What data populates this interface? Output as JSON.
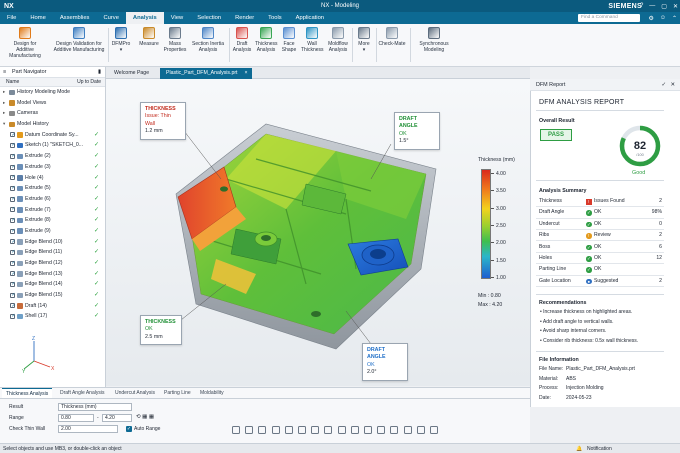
{
  "app": {
    "logo": "NX",
    "window_title": "NX - Modeling",
    "brand": "SIEMENS",
    "window_controls": [
      "?",
      "—",
      "▢",
      "✕"
    ]
  },
  "menu": {
    "items": [
      "File",
      "Home",
      "Assemblies",
      "Curve",
      "Analysis",
      "View",
      "Selection",
      "Render",
      "Tools",
      "Application"
    ],
    "active": "Analysis",
    "search_placeholder": "Find a Command"
  },
  "ribbon": {
    "buttons": [
      {
        "label": "Design for\nAdditive Manufacturing",
        "icon": "additive-icon",
        "color": "#e07b1a"
      },
      {
        "label": "Design Validation for\nAdditive Manufacturing",
        "icon": "validation-icon",
        "color": "#3f7fc1"
      },
      {
        "label": "DFMPro\n▾",
        "icon": "dfmpro-icon",
        "color": "#2c6fb0"
      },
      {
        "label": "Measure",
        "icon": "measure-icon",
        "color": "#c98a2a"
      },
      {
        "label": "Mass\nProperties",
        "icon": "mass-icon",
        "color": "#6b7b8c"
      },
      {
        "label": "Section Inertia\nAnalysis",
        "icon": "section-icon",
        "color": "#4f86c6"
      },
      {
        "label": "Draft\nAnalysis",
        "icon": "draft-icon",
        "color": "#d9534f"
      },
      {
        "label": "Thickness\nAnalysis",
        "icon": "thickness-icon",
        "color": "#3aa655"
      },
      {
        "label": "Face\nShape",
        "icon": "face-icon",
        "color": "#5b8fd1"
      },
      {
        "label": "Wall\nThickness",
        "icon": "wall-icon",
        "color": "#2f95c4"
      },
      {
        "label": "Moldflow\nAnalysis",
        "icon": "moldflow-icon",
        "color": "#8a9aab"
      },
      {
        "label": "More\n▾",
        "icon": "more-icon",
        "color": "#6b7b8c"
      },
      {
        "label": "Check-Mate",
        "icon": "checkmate-icon",
        "color": "#8a9aab"
      },
      {
        "label": "Synchronous\nModeling",
        "icon": "sync-icon",
        "color": "#5d6d7e"
      }
    ]
  },
  "navigator": {
    "title": "Part Navigator",
    "col_name": "Name",
    "col_uptodate": "Up to Date",
    "rows": [
      {
        "label": "History Modeling Mode",
        "indent": 1,
        "cb": false,
        "chk": false
      },
      {
        "label": "Model Views",
        "indent": 1,
        "cb": false,
        "chk": false
      },
      {
        "label": "Cameras",
        "indent": 1,
        "cb": false,
        "chk": false
      },
      {
        "label": "Model History",
        "indent": 1,
        "cb": false,
        "chk": false
      },
      {
        "label": "Datum Coordinate Sy...",
        "indent": 2,
        "cb": true,
        "chk": true
      },
      {
        "label": "Sketch (1) \"SKETCH_0...",
        "indent": 2,
        "cb": true,
        "chk": true
      },
      {
        "label": "Extrude (2)",
        "indent": 2,
        "cb": true,
        "chk": true
      },
      {
        "label": "Extrude (3)",
        "indent": 2,
        "cb": true,
        "chk": true
      },
      {
        "label": "Hole (4)",
        "indent": 2,
        "cb": true,
        "chk": true
      },
      {
        "label": "Extrude (5)",
        "indent": 2,
        "cb": true,
        "chk": true
      },
      {
        "label": "Extrude (6)",
        "indent": 2,
        "cb": true,
        "chk": true
      },
      {
        "label": "Extrude (7)",
        "indent": 2,
        "cb": true,
        "chk": true
      },
      {
        "label": "Extrude (8)",
        "indent": 2,
        "cb": true,
        "chk": true
      },
      {
        "label": "Extrude (9)",
        "indent": 2,
        "cb": true,
        "chk": true
      },
      {
        "label": "Edge Blend (10)",
        "indent": 2,
        "cb": true,
        "chk": true
      },
      {
        "label": "Edge Blend (11)",
        "indent": 2,
        "cb": true,
        "chk": true
      },
      {
        "label": "Edge Blend (12)",
        "indent": 2,
        "cb": true,
        "chk": true
      },
      {
        "label": "Edge Blend (13)",
        "indent": 2,
        "cb": true,
        "chk": true
      },
      {
        "label": "Edge Blend (14)",
        "indent": 2,
        "cb": true,
        "chk": true
      },
      {
        "label": "Edge Blend (15)",
        "indent": 2,
        "cb": true,
        "chk": true
      },
      {
        "label": "Draft (14)",
        "indent": 2,
        "cb": true,
        "chk": true
      },
      {
        "label": "Shell (17)",
        "indent": 2,
        "cb": true,
        "chk": true
      }
    ],
    "triad": {
      "x": "X",
      "y": "Y",
      "z": "Z"
    }
  },
  "doc_tabs": {
    "welcome": "Welcome Page",
    "active": "Plastic_Part_DFM_Analysis.prt",
    "close": "×"
  },
  "viewport": {
    "callouts": {
      "thickness_issue": {
        "title": "THICKNESS",
        "line2": "Issue: Thin Wall",
        "line3": "1.2 mm"
      },
      "draft_top": {
        "title": "DRAFT ANGLE",
        "line2": "OK",
        "line3": "1.5°"
      },
      "thickness_ok": {
        "title": "THICKNESS",
        "line2": "OK",
        "line3": "2.5 mm"
      },
      "draft_bottom": {
        "title": "DRAFT ANGLE",
        "line2": "OK",
        "line3": "2.0°"
      }
    },
    "legend": {
      "title": "Thickness (mm)",
      "ticks": [
        "4.00",
        "3.50",
        "3.00",
        "2.50",
        "2.00",
        "1.50",
        "1.00"
      ],
      "min_label": "Min : 0.80",
      "max_label": "Max : 4.20"
    }
  },
  "dfm": {
    "panel_title": "DFM Report",
    "report_title": "DFM ANALYSIS REPORT",
    "overall_label": "Overall Result",
    "pass_label": "PASS",
    "score": 82,
    "score_max": "/100",
    "score_fraction": 0.82,
    "score_text": "Good",
    "summary_title": "Analysis Summary",
    "summary": [
      {
        "name": "Thickness",
        "status": "Issues Found",
        "value": "2",
        "kind": "warn"
      },
      {
        "name": "Draft Angle",
        "status": "OK",
        "value": "98%",
        "kind": "ok"
      },
      {
        "name": "Undercut",
        "status": "OK",
        "value": "0",
        "kind": "ok"
      },
      {
        "name": "Ribs",
        "status": "Review",
        "value": "2",
        "kind": "review"
      },
      {
        "name": "Boss",
        "status": "OK",
        "value": "6",
        "kind": "ok"
      },
      {
        "name": "Holes",
        "status": "OK",
        "value": "12",
        "kind": "ok"
      },
      {
        "name": "Parting Line",
        "status": "OK",
        "value": "",
        "kind": "ok"
      },
      {
        "name": "Gate Location",
        "status": "Suggested",
        "value": "2",
        "kind": "info"
      }
    ],
    "recommendations_title": "Recommendations",
    "recommendations": [
      "• Increase thickness on highlighted areas.",
      "• Add draft angle to vertical walls.",
      "• Avoid sharp internal corners.",
      "• Consider rib thickness: 0.5x wall thickness."
    ],
    "fileinfo_title": "File Information",
    "fileinfo": [
      {
        "k": "File Name:",
        "v": "Plastic_Part_DFM_Analysis.prt"
      },
      {
        "k": "Material:",
        "v": "ABS"
      },
      {
        "k": "Process:",
        "v": "Injection Molding"
      },
      {
        "k": "Date:",
        "v": "2024-05-23"
      }
    ],
    "status_colors": {
      "ok": "#2e9d43",
      "warn": "#d93a2b",
      "review": "#e39a1c",
      "info": "#2f6fc1"
    }
  },
  "bottom": {
    "tabs": [
      "Thickness Analysis",
      "Draft Angle Analysis",
      "Undercut Analysis",
      "Parting Line",
      "Moldability"
    ],
    "result_label": "Result",
    "result_value": "Thickness (mm)",
    "range_label": "Range",
    "range_min": "0.80",
    "range_max": "4.20",
    "range_sep": "-",
    "check_label": "Check Thin Wall",
    "check_value": "2.00",
    "auto_range_label": "Auto Range"
  },
  "status": {
    "message": "Select objects and use MB3, or double-click an object",
    "notification": "Notification"
  }
}
